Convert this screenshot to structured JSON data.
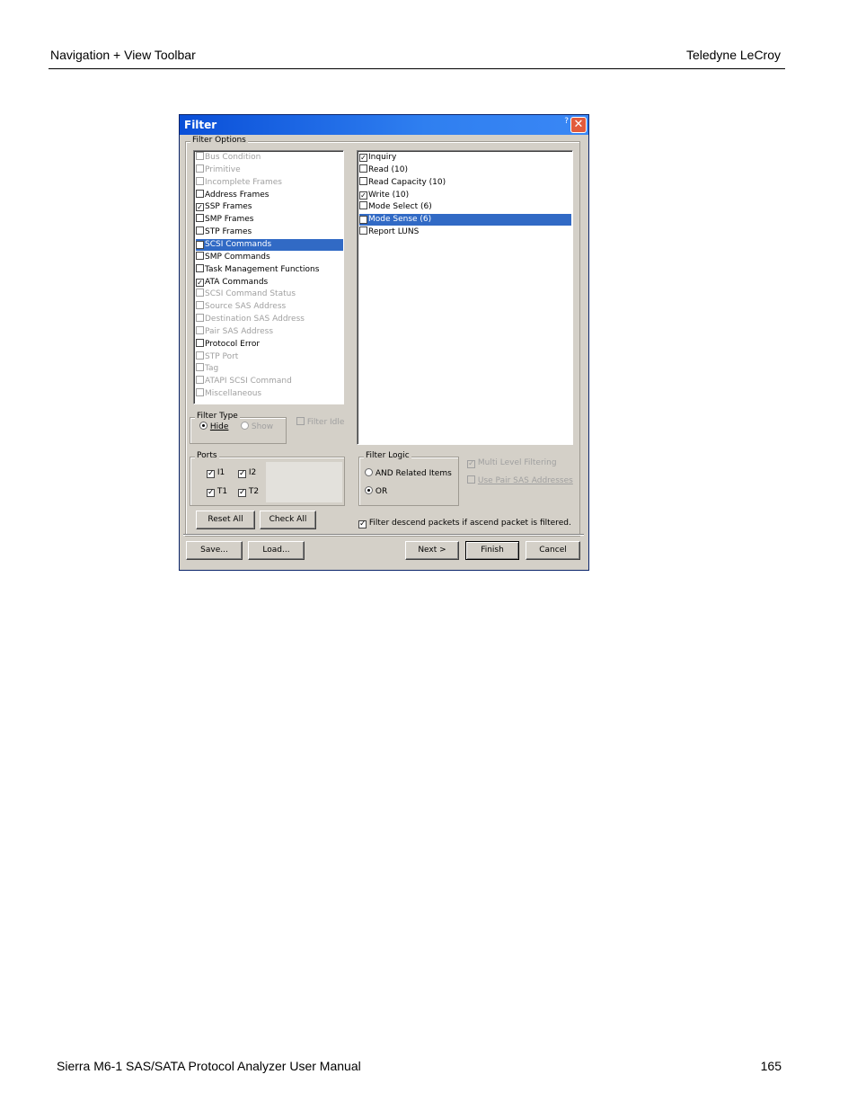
{
  "page": {
    "header_left": "Navigation + View Toolbar",
    "header_right": "Teledyne LeCroy",
    "footer_left": "Sierra M6-1 SAS/SATA Protocol Analyzer User Manual",
    "footer_right": "165"
  },
  "dialog": {
    "title": "Filter",
    "help_mark": "?",
    "close_glyph": "✕",
    "filter_options_label": "Filter Options",
    "left_list": [
      {
        "label": "Bus Condition",
        "checked": false,
        "disabled": true
      },
      {
        "label": "Primitive",
        "checked": false,
        "disabled": true
      },
      {
        "label": "Incomplete Frames",
        "checked": false,
        "disabled": true
      },
      {
        "label": "Address Frames",
        "checked": false,
        "disabled": false
      },
      {
        "label": "SSP Frames",
        "checked": true,
        "disabled": false
      },
      {
        "label": "SMP Frames",
        "checked": false,
        "disabled": false
      },
      {
        "label": "STP Frames",
        "checked": false,
        "disabled": false
      },
      {
        "label": "SCSI Commands",
        "checked": true,
        "disabled": false,
        "selected": true
      },
      {
        "label": "SMP Commands",
        "checked": false,
        "disabled": false
      },
      {
        "label": "Task Management Functions",
        "checked": false,
        "disabled": false
      },
      {
        "label": "ATA Commands",
        "checked": true,
        "disabled": false
      },
      {
        "label": "SCSI Command Status",
        "checked": false,
        "disabled": true
      },
      {
        "label": "Source SAS Address",
        "checked": false,
        "disabled": true
      },
      {
        "label": "Destination SAS Address",
        "checked": false,
        "disabled": true
      },
      {
        "label": "Pair SAS Address",
        "checked": false,
        "disabled": true
      },
      {
        "label": "Protocol Error",
        "checked": false,
        "disabled": false
      },
      {
        "label": "STP Port",
        "checked": false,
        "disabled": true
      },
      {
        "label": "Tag",
        "checked": false,
        "disabled": true
      },
      {
        "label": "ATAPI SCSI Command",
        "checked": false,
        "disabled": true
      },
      {
        "label": "Miscellaneous",
        "checked": false,
        "disabled": true
      }
    ],
    "right_list": [
      {
        "label": "Inquiry",
        "checked": true
      },
      {
        "label": "Read (10)",
        "checked": false
      },
      {
        "label": "Read Capacity (10)",
        "checked": false
      },
      {
        "label": "Write (10)",
        "checked": true
      },
      {
        "label": "Mode Select (6)",
        "checked": false
      },
      {
        "label": "Mode Sense (6)",
        "checked": true,
        "selected": true
      },
      {
        "label": "Report LUNS",
        "checked": false
      }
    ],
    "filter_type": {
      "label": "Filter Type",
      "hide": "Hide",
      "show": "Show",
      "selected": "Hide"
    },
    "filter_idle": "Filter Idle",
    "ports": {
      "label": "Ports",
      "items": [
        {
          "label": "I1",
          "checked": true
        },
        {
          "label": "I2",
          "checked": true
        },
        {
          "label": "T1",
          "checked": true
        },
        {
          "label": "T2",
          "checked": true
        }
      ]
    },
    "filter_logic": {
      "label": "Filter Logic",
      "and": "AND Related Items",
      "or": "OR",
      "selected": "OR"
    },
    "multi_level": "Multi Level Filtering",
    "use_pair": "Use Pair SAS Addresses",
    "descend": "Filter descend packets if ascend packet is filtered.",
    "buttons": {
      "reset_all": "Reset All",
      "check_all": "Check All",
      "save": "Save...",
      "load": "Load...",
      "next": "Next >",
      "finish": "Finish",
      "cancel": "Cancel"
    },
    "check_glyph": "✓"
  }
}
